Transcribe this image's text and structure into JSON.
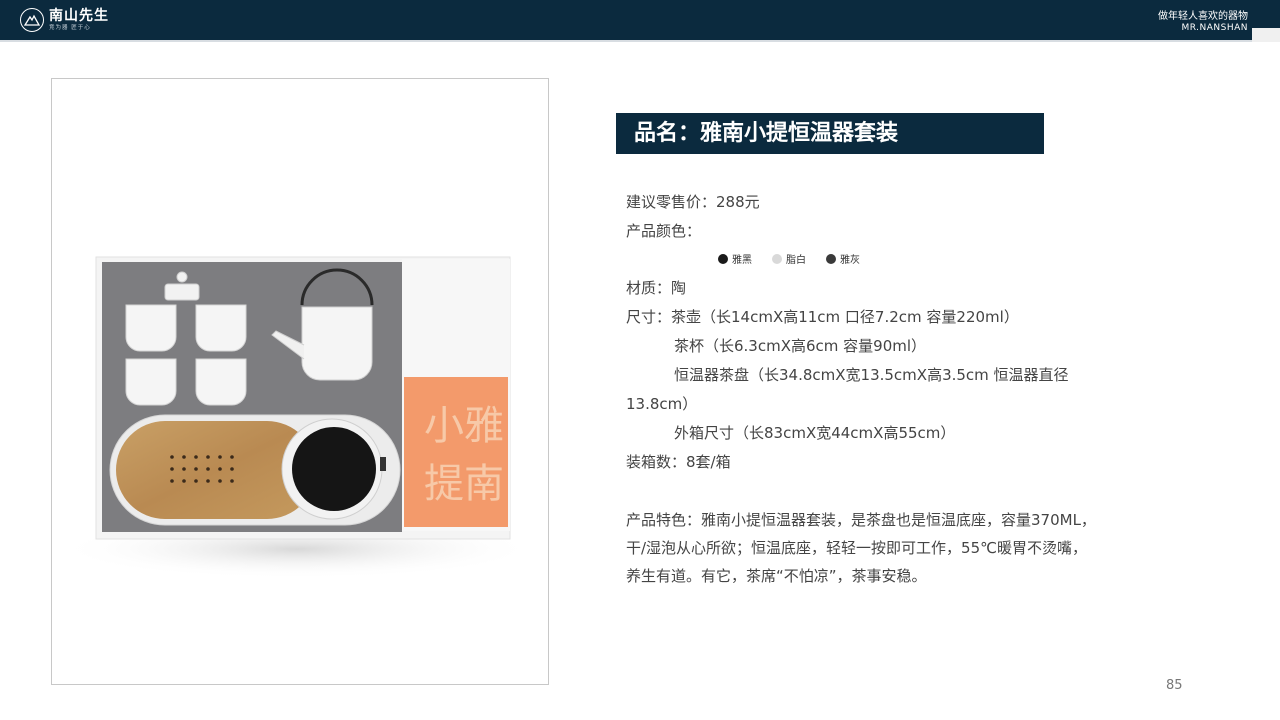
{
  "header": {
    "brand_name": "南山先生",
    "brand_sub": "竞为器 匠于心",
    "slogan_cn": "做年轻人喜欢的器物",
    "slogan_en": "MR.NANSHAN"
  },
  "product": {
    "title": "品名：雅南小提恒温器套装",
    "price": "建议零售价：288元",
    "color_label": "产品颜色：",
    "colors": [
      {
        "name": "雅黑",
        "hex": "#1a1a1a"
      },
      {
        "name": "脂白",
        "hex": "#d9d9d9"
      },
      {
        "name": "雅灰",
        "hex": "#3a3a3a"
      }
    ],
    "material": "材质：陶",
    "size_1": "尺寸：茶壶（长14cmX高11cm  口径7.2cm 容量220ml）",
    "size_2": "茶杯（长6.3cmX高6cm  容量90ml）",
    "size_3": "恒温器茶盘（长34.8cmX宽13.5cmX高3.5cm  恒温器直径",
    "size_3b": "13.8cm）",
    "size_4": "外箱尺寸（长83cmX宽44cmX高55cm）",
    "packing": "装箱数：8套/箱",
    "feature_1": "产品特色：雅南小提恒温器套装，是茶盘也是恒温底座，容量370ML，",
    "feature_2": "干/湿泡从心所欲；恒温底座，轻轻一按即可工作，55℃暖胃不烫嘴，",
    "feature_3": "养生有道。有它，茶席“不怕凉”，茶事安稳。"
  },
  "box_text": {
    "c1": "小",
    "c2": "雅",
    "c3": "提",
    "c4": "南"
  },
  "page_number": "85"
}
